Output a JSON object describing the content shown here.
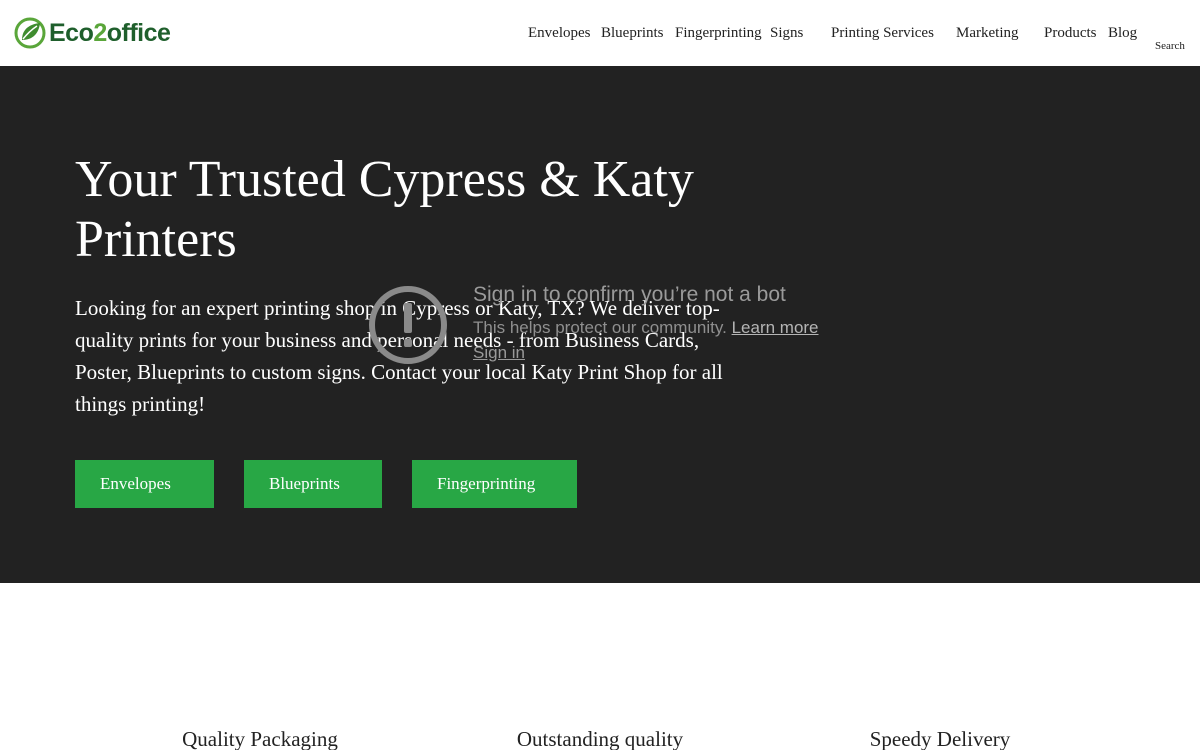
{
  "header": {
    "logo": {
      "part1": "Eco",
      "part2": "2",
      "part3": "office"
    },
    "nav": [
      {
        "label": "Envelopes"
      },
      {
        "label": "Blueprints"
      },
      {
        "label": "Fingerprinting"
      },
      {
        "label": "Signs"
      },
      {
        "label": "Printing Services"
      },
      {
        "label": "Marketing"
      },
      {
        "label": "Products"
      },
      {
        "label": "Blog"
      }
    ],
    "search_label": "Search"
  },
  "hero": {
    "title": "Your Trusted Cypress & Katy Printers",
    "text": "Looking for an expert printing shop in Cypress or Katy, TX? We deliver top-quality prints for your business and personal needs - from Business Cards, Poster, Blueprints to custom signs. Contact your local Katy Print Shop for all things printing!",
    "buttons": [
      {
        "label": "Envelopes"
      },
      {
        "label": "Blueprints"
      },
      {
        "label": "Fingerprinting"
      }
    ],
    "background_color": "#222222",
    "button_color": "#28a745"
  },
  "bot_check": {
    "title": "Sign in to confirm you’re not a bot",
    "description": "This helps protect our community.",
    "learn_more": "Learn more",
    "sign_in": "Sign in"
  },
  "features": [
    {
      "label": "Quality Packaging"
    },
    {
      "label": "Outstanding quality"
    },
    {
      "label": "Speedy Delivery"
    }
  ]
}
